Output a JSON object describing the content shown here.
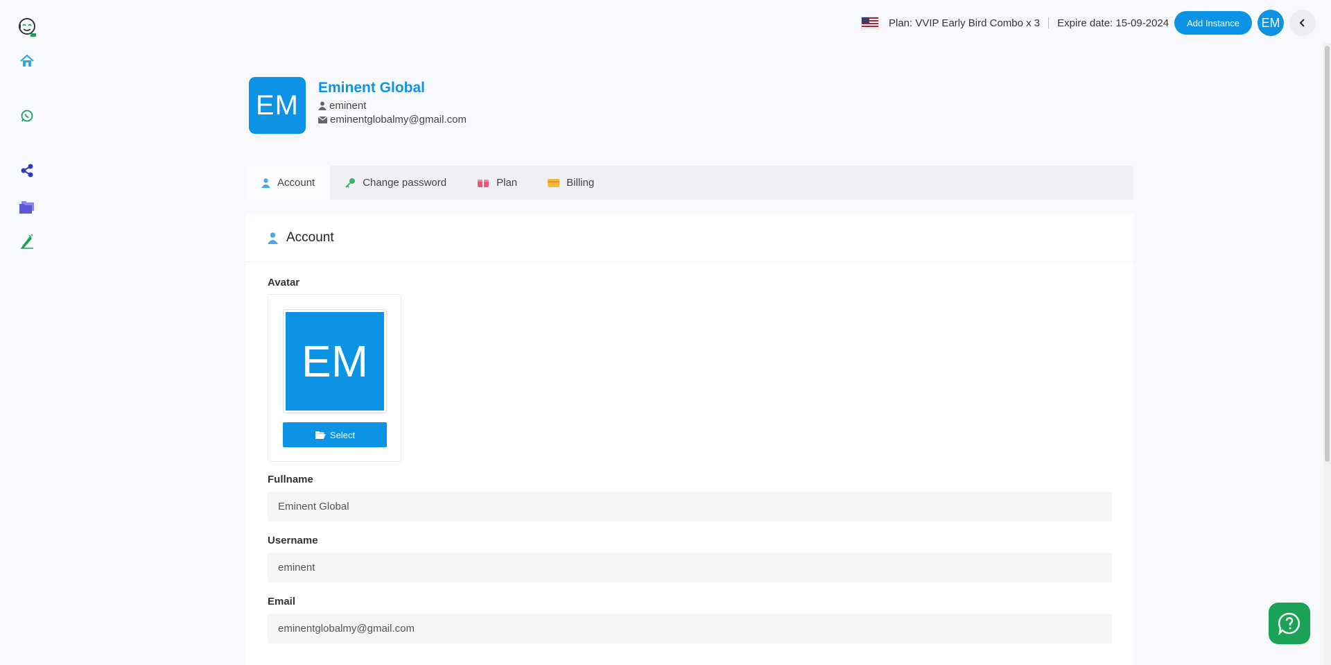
{
  "sidebar": {
    "items": [
      {
        "name": "logo",
        "icon": "chatbot-logo-icon"
      },
      {
        "name": "home",
        "icon": "home-icon"
      },
      {
        "name": "whatsapp",
        "icon": "whatsapp-icon"
      },
      {
        "name": "share",
        "icon": "share-icon"
      },
      {
        "name": "folders",
        "icon": "folder-icon"
      },
      {
        "name": "edit",
        "icon": "pencil-icon"
      }
    ]
  },
  "topbar": {
    "plan_text": "Plan: VVIP Early Bird Combo x 3",
    "expire_text": "Expire date: 15-09-2024",
    "add_instance_label": "Add Instance",
    "avatar_initials": "EM"
  },
  "profile": {
    "logo_initials": "EM",
    "name": "Eminent Global",
    "username": "eminent",
    "email": "eminentglobalmy@gmail.com"
  },
  "tabs": [
    {
      "label": "Account",
      "active": true
    },
    {
      "label": "Change password",
      "active": false
    },
    {
      "label": "Plan",
      "active": false
    },
    {
      "label": "Billing",
      "active": false
    }
  ],
  "account": {
    "title": "Account",
    "avatar_label": "Avatar",
    "avatar_initials": "EM",
    "select_label": "Select",
    "fields": [
      {
        "label": "Fullname",
        "value": "Eminent Global"
      },
      {
        "label": "Username",
        "value": "eminent"
      },
      {
        "label": "Email",
        "value": "eminentglobalmy@gmail.com"
      }
    ]
  },
  "colors": {
    "accent": "#0d93e6",
    "chat_green": "#1aa357"
  }
}
